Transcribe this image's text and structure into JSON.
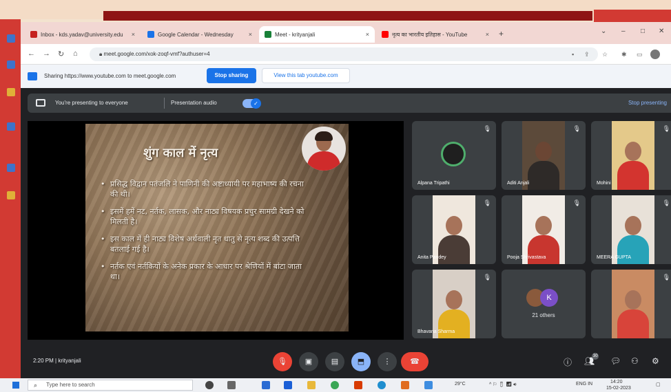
{
  "browser": {
    "tabs": [
      {
        "label": "Inbox - kds.yadav@university.edu",
        "color": "#c5221f"
      },
      {
        "label": "Google Calendar - Wednesday",
        "color": "#1a73e8"
      },
      {
        "label": "Meet - krityanjali",
        "color": "#188038"
      },
      {
        "label": "नृत्य का भारतीय इतिहास - YouTube",
        "color": "#ff0000"
      }
    ],
    "new_tab": "+",
    "url": "meet.google.com/xok-zoqf-vmf?authuser=4"
  },
  "share_bar": {
    "text": "Sharing https://www.youtube.com to meet.google.com",
    "stop_label": "Stop sharing",
    "switch_label": "View this tab youtube.com"
  },
  "meet": {
    "presenting_text": "You're presenting to everyone",
    "audio_label": "Presentation audio",
    "stop_presenting": "Stop presenting",
    "slide": {
      "title": "शुंग काल में नृत्य",
      "points": [
        "प्रसिद्ध विद्वान पतंजलि ने पाणिनी की अष्टाध्यायी पर महाभाष्य की रचना की थी।",
        "इसमें हमें नट, नर्तक, लासक, और नाट्य विषयक प्रचुर सामग्री देखने को मिलती है।",
        "इस काल में ही नाट्य विशेष अर्थवाली नृत धातु से नृत्य शब्द की उत्पत्ति बतलाई गई है।",
        "नर्तक एवं नर्तकियों के अनेक प्रकार के आधार पर श्रेणियों में बांटा जाता था।"
      ]
    },
    "participants": [
      {
        "name": "Alpana Tripathi"
      },
      {
        "name": "Aditi Anjali"
      },
      {
        "name": "Mohini"
      },
      {
        "name": "Anita Pandey"
      },
      {
        "name": "Pooja Shrivastava"
      },
      {
        "name": "MEERA GUPTA"
      },
      {
        "name": "Bhavana Sharma"
      },
      {
        "name": ""
      }
    ],
    "others": {
      "label": "21 others",
      "initial": "K"
    },
    "clock": "2:20 PM | krityanjali",
    "raise_badge": "30"
  },
  "taskbar": {
    "search_placeholder": "Type here to search",
    "weather": "29°C",
    "language": "ENG IN",
    "time": "14:20",
    "date": "15-02-2023"
  }
}
